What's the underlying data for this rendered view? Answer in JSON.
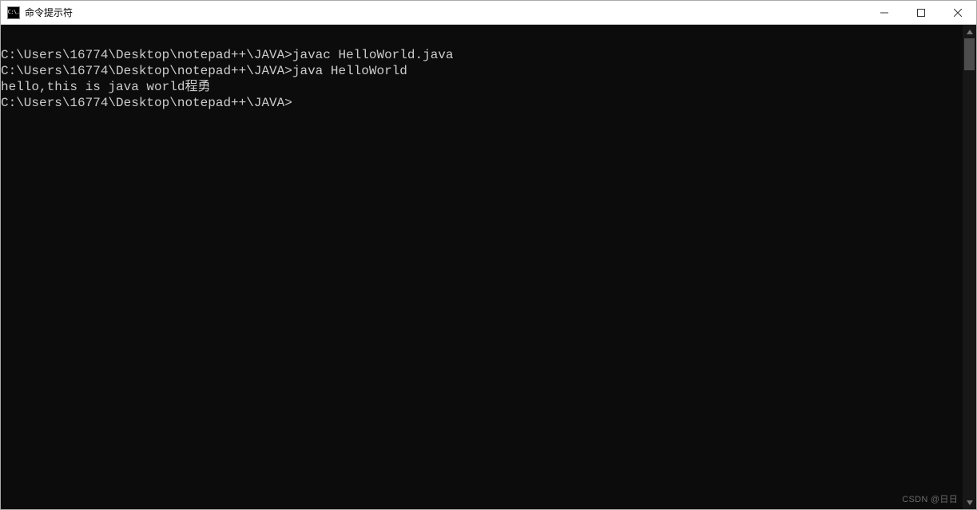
{
  "window": {
    "icon_text": "C:\\.",
    "title": "命令提示符"
  },
  "terminal": {
    "lines": [
      {
        "prompt": "C:\\Users\\16774\\Desktop\\notepad++\\JAVA>",
        "command": "javac HelloWorld.java"
      },
      {
        "text": ""
      },
      {
        "prompt": "C:\\Users\\16774\\Desktop\\notepad++\\JAVA>",
        "command": "java HelloWorld"
      },
      {
        "text": "hello,this is java world程勇"
      },
      {
        "text": ""
      },
      {
        "prompt": "C:\\Users\\16774\\Desktop\\notepad++\\JAVA>",
        "command": ""
      }
    ]
  },
  "watermark": "CSDN @日日"
}
